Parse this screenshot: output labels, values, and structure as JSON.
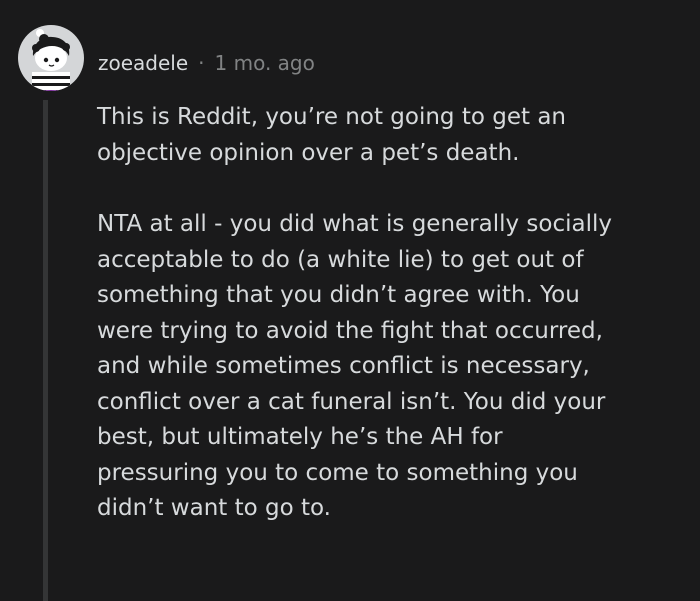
{
  "comment": {
    "username": "zoeadele",
    "separator": "·",
    "timestamp": "1 mo. ago",
    "paragraphs": [
      "This is Reddit, you’re not going to get an\nobjective opinion over a pet’s death.",
      "NTA at all - you did what is generally socially\nacceptable to do (a white lie) to get out of\nsomething that you didn’t agree with. You\nwere trying to avoid the fight that occurred,\nand while sometimes conflict is necessary,\nconflict over a cat funeral isn’t. You did your\nbest, but ultimately he’s the AH for\npressuring you to come to something you\ndidn’t want to go to."
    ]
  },
  "colors": {
    "background": "#1a1a1b",
    "text": "#d7dadc",
    "muted": "#818384",
    "thread_line": "#343536"
  },
  "icons": {
    "avatar": "snoo-avatar-icon"
  }
}
